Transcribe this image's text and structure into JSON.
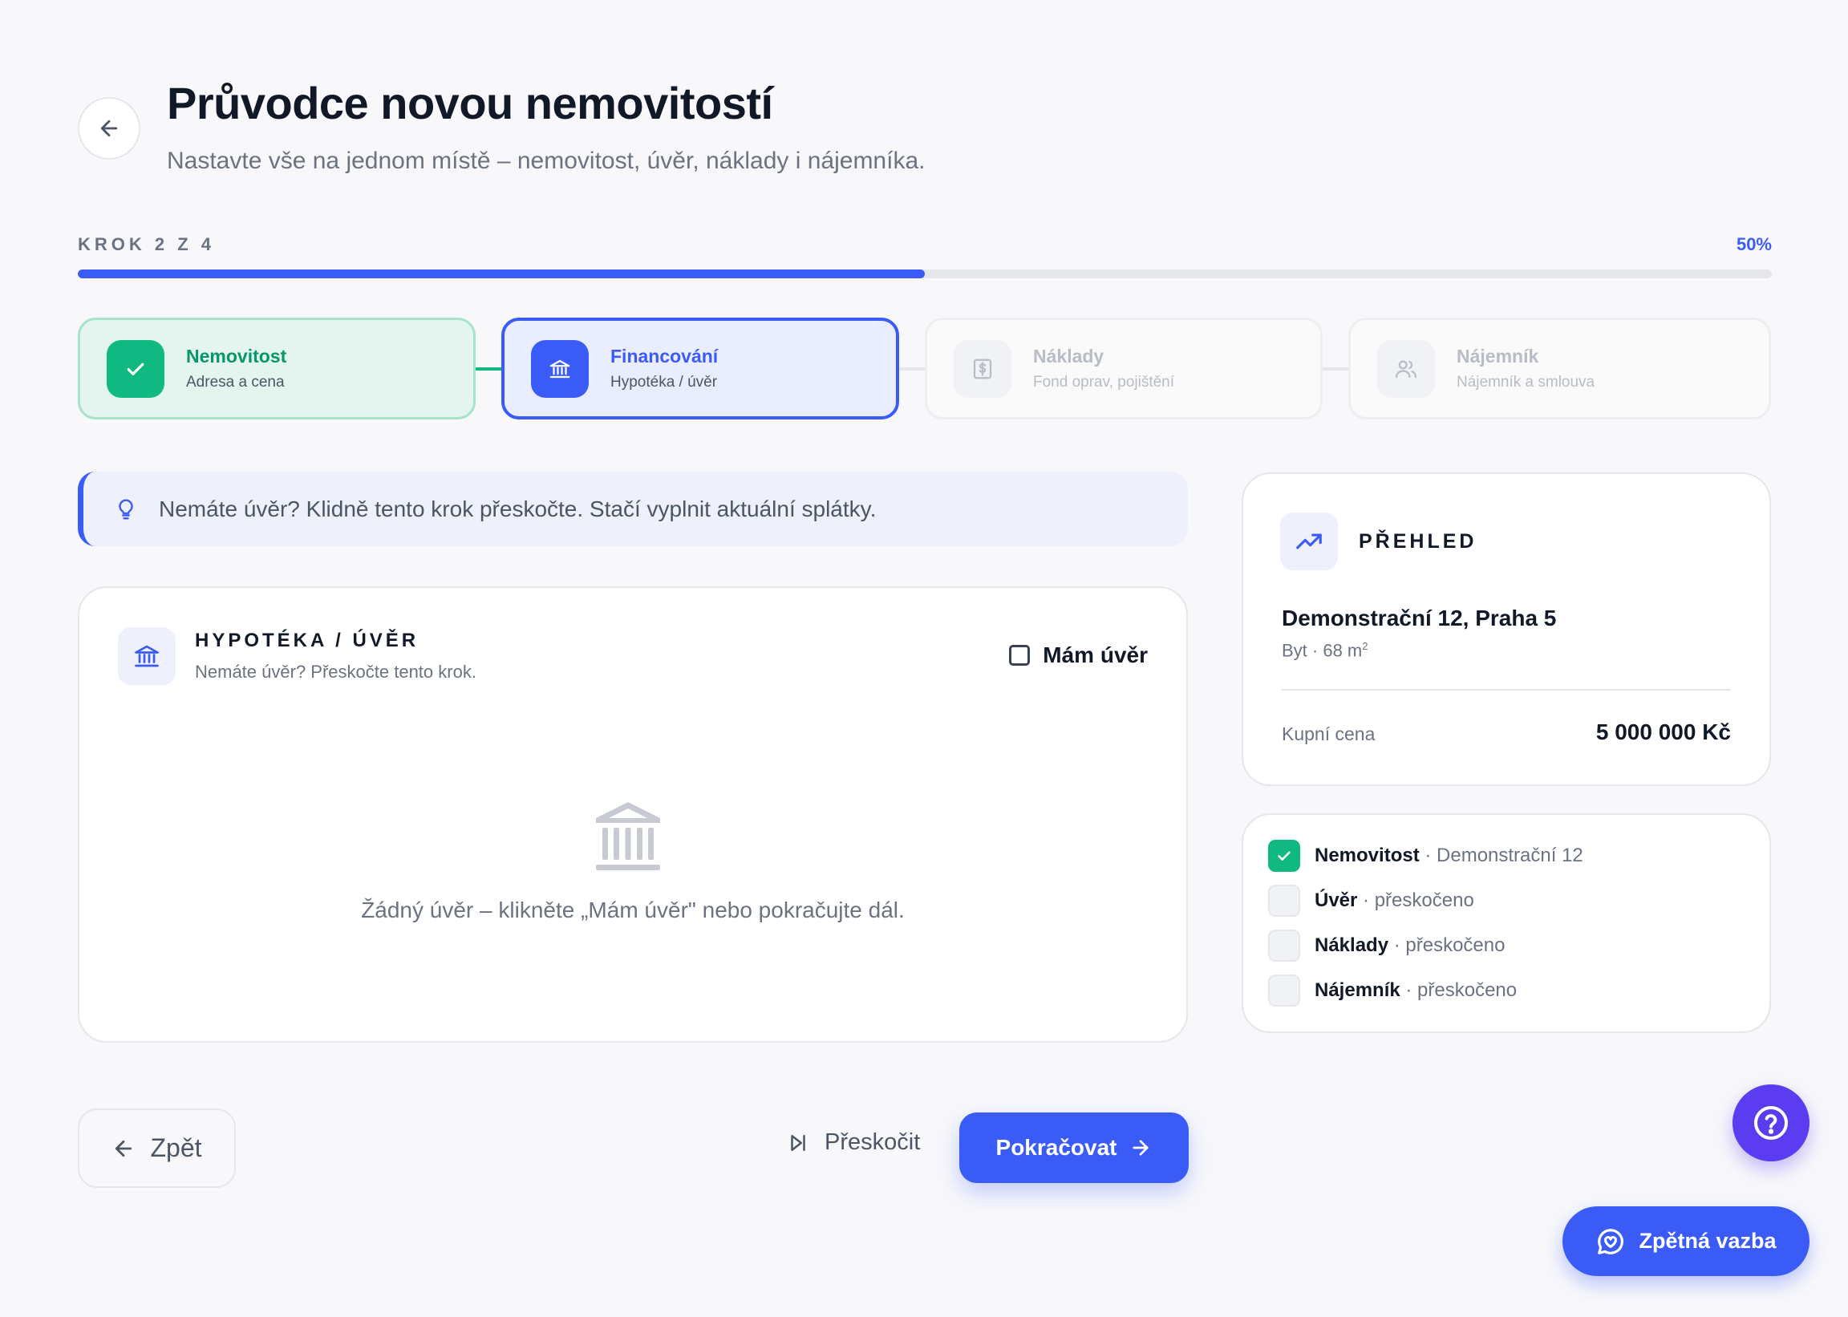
{
  "header": {
    "title": "Průvodce novou nemovitostí",
    "subtitle": "Nastavte vše na jednom místě – nemovitost, úvěr, náklady i nájemníka."
  },
  "progress": {
    "step_label": "KROK 2 Z 4",
    "percent_label": "50%",
    "percent": 50
  },
  "steps": [
    {
      "title": "Nemovitost",
      "desc": "Adresa a cena",
      "state": "done",
      "icon": "check-icon"
    },
    {
      "title": "Financování",
      "desc": "Hypotéka / úvěr",
      "state": "active",
      "icon": "bank-icon"
    },
    {
      "title": "Náklady",
      "desc": "Fond oprav, pojištění",
      "state": "todo",
      "icon": "receipt-icon"
    },
    {
      "title": "Nájemník",
      "desc": "Nájemník a smlouva",
      "state": "todo",
      "icon": "users-icon"
    }
  ],
  "tip": {
    "text": "Nemáte úvěr? Klidně tento krok přeskočte. Stačí vyplnit aktuální splátky."
  },
  "loan_card": {
    "title": "HYPOTÉKA / ÚVĚR",
    "subtitle": "Nemáte úvěr? Přeskočte tento krok.",
    "checkbox_label": "Mám úvěr",
    "empty_text": "Žádný úvěr – klikněte „Mám úvěr\" nebo pokračujte dál."
  },
  "footer": {
    "back_label": "Zpět",
    "skip_label": "Přeskočit",
    "continue_label": "Pokračovat"
  },
  "summary": {
    "title": "PŘEHLED",
    "address": "Demonstrační 12, Praha 5",
    "meta": "Byt · 68 m",
    "meta_sup": "2",
    "price_label": "Kupní cena",
    "price_value": "5 000 000 Kč"
  },
  "checklist": [
    {
      "name": "Nemovitost",
      "detail": "· Demonstrační 12",
      "done": true
    },
    {
      "name": "Úvěr",
      "detail": "· přeskočeno",
      "done": false
    },
    {
      "name": "Náklady",
      "detail": "· přeskočeno",
      "done": false
    },
    {
      "name": "Nájemník",
      "detail": "· přeskočeno",
      "done": false
    }
  ],
  "floating": {
    "feedback_label": "Zpětná vazba"
  },
  "colors": {
    "accent": "#3b5bf6",
    "success": "#10b981",
    "help": "#5b3cf0"
  }
}
